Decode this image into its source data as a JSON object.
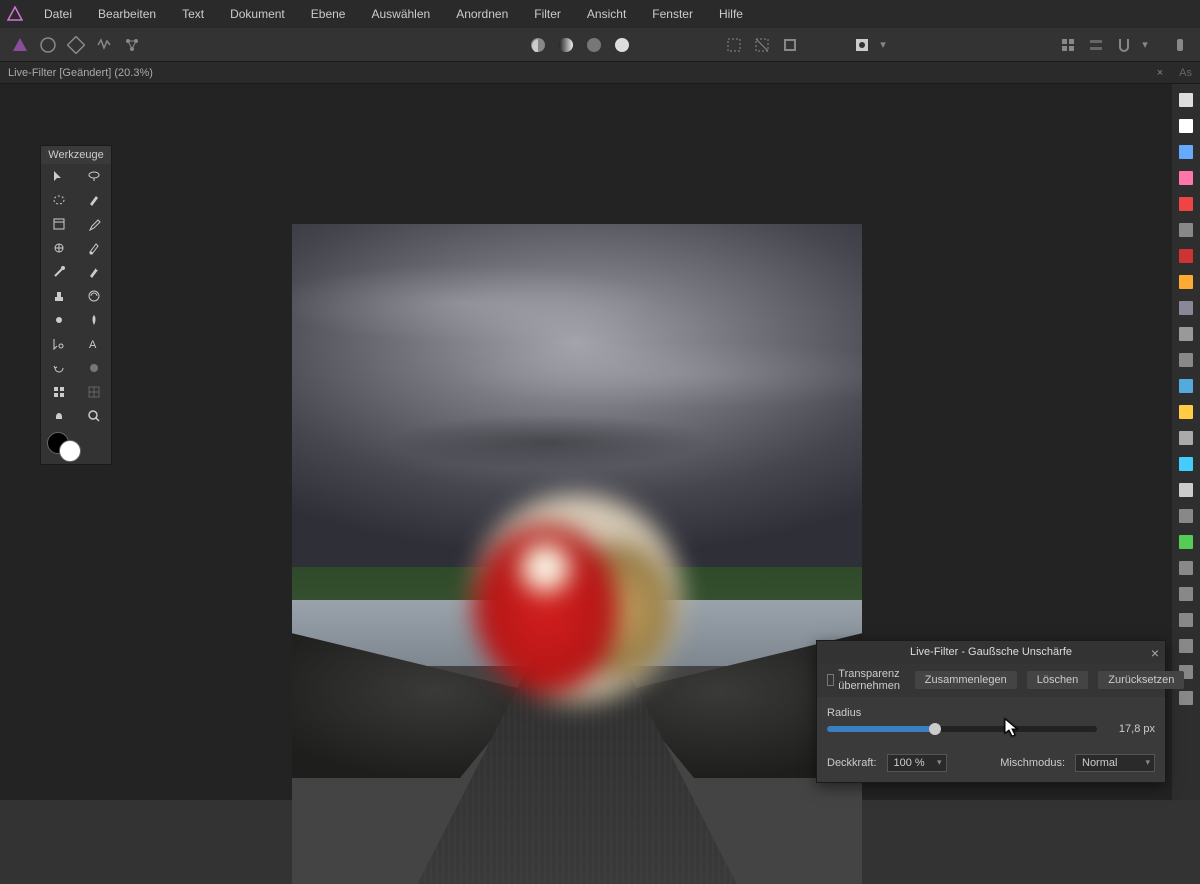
{
  "menu": {
    "items": [
      "Datei",
      "Bearbeiten",
      "Text",
      "Dokument",
      "Ebene",
      "Auswählen",
      "Anordnen",
      "Filter",
      "Ansicht",
      "Fenster",
      "Hilfe"
    ]
  },
  "document": {
    "tab_title": "Live-Filter [Geändert] (20.3%)"
  },
  "tools_panel": {
    "title": "Werkzeuge",
    "tool_names": [
      "move-tool",
      "lasso-tool",
      "ellipse-select-tool",
      "brush-tool",
      "crop-tool",
      "eyedropper-tool",
      "selection-brush-tool",
      "retouch-brush-tool",
      "pen-tool",
      "healing-brush-tool",
      "clone-tool",
      "paint-mix-tool",
      "blur-tool",
      "dodge-tool",
      "node-tool",
      "text-tool",
      "rotate-tool",
      "shape-tool",
      "mesh-tool",
      "grid-tool",
      "pan-tool",
      "zoom-tool"
    ]
  },
  "right_strip": {
    "icons": [
      "histogram-icon",
      "swatches-icon",
      "color-icon",
      "channels-icon",
      "adjustments-icon",
      "info-icon",
      "gradient-icon",
      "stripes-icon",
      "navigator-icon",
      "levels-icon",
      "lines-icon",
      "curves-icon",
      "hsl-icon",
      "layers-icon",
      "assistant-icon",
      "target-icon",
      "effects-icon",
      "styles-icon",
      "macros-icon",
      "history-icon",
      "snapshots-icon",
      "stock-icon",
      "transform-icon",
      "character-icon"
    ]
  },
  "dialog": {
    "title": "Live-Filter - Gaußsche Unschärfe",
    "transparency_label": "Transparenz übernehmen",
    "merge_label": "Zusammenlegen",
    "delete_label": "Löschen",
    "reset_label": "Zurücksetzen",
    "radius_label": "Radius",
    "radius_value": "17,8 px",
    "opacity_label": "Deckkraft:",
    "opacity_value": "100 %",
    "blendmode_label": "Mischmodus:",
    "blendmode_value": "Normal"
  },
  "right_tab_hint": "As"
}
